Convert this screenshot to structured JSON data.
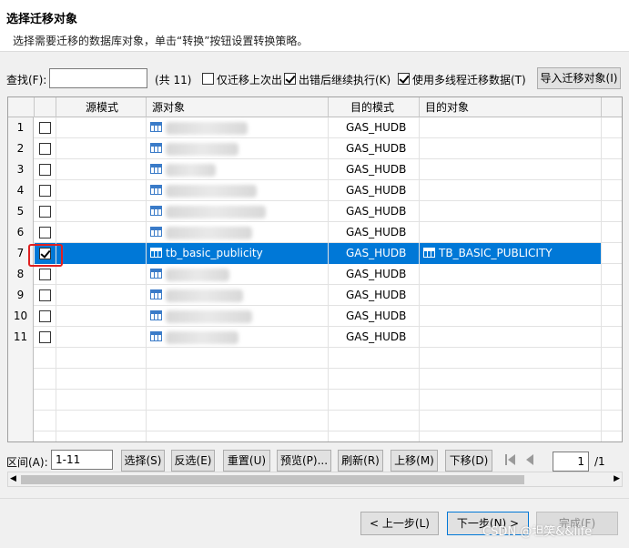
{
  "header": {
    "title": "选择迁移对象",
    "subtitle": "选择需要迁移的数据库对象，单击“转换”按钮设置转换策略。"
  },
  "toolbar": {
    "find_label": "查找(F):",
    "find_value": "",
    "count_text": "(共 11)",
    "opt_only_last_failed": {
      "label": "仅迁移上次出",
      "checked": false
    },
    "opt_continue_on_error": {
      "label": "出错后继续执行(K)",
      "checked": true
    },
    "opt_multithread": {
      "label": "使用多线程迁移数据(T)",
      "checked": true
    },
    "import_button": "导入迁移对象(I)"
  },
  "grid": {
    "columns": [
      "",
      "源模式",
      "源对象",
      "目的模式",
      "目的对象"
    ],
    "rows": [
      {
        "num": "1",
        "checked": false,
        "source_object": "",
        "target_schema": "GAS_HUDB",
        "target_object": "",
        "selected": false
      },
      {
        "num": "2",
        "checked": false,
        "source_object": "",
        "target_schema": "GAS_HUDB",
        "target_object": "",
        "selected": false
      },
      {
        "num": "3",
        "checked": false,
        "source_object": "",
        "target_schema": "GAS_HUDB",
        "target_object": "",
        "selected": false
      },
      {
        "num": "4",
        "checked": false,
        "source_object": "",
        "target_schema": "GAS_HUDB",
        "target_object": "",
        "selected": false
      },
      {
        "num": "5",
        "checked": false,
        "source_object": "",
        "target_schema": "GAS_HUDB",
        "target_object": "",
        "selected": false
      },
      {
        "num": "6",
        "checked": false,
        "source_object": "",
        "target_schema": "GAS_HUDB",
        "target_object": "",
        "selected": false
      },
      {
        "num": "7",
        "checked": true,
        "source_object": "tb_basic_publicity",
        "target_schema": "GAS_HUDB",
        "target_object": "TB_BASIC_PUBLICITY",
        "selected": true
      },
      {
        "num": "8",
        "checked": false,
        "source_object": "",
        "target_schema": "GAS_HUDB",
        "target_object": "",
        "selected": false
      },
      {
        "num": "9",
        "checked": false,
        "source_object": "",
        "target_schema": "GAS_HUDB",
        "target_object": "",
        "selected": false
      },
      {
        "num": "10",
        "checked": false,
        "source_object": "",
        "target_schema": "GAS_HUDB",
        "target_object": "",
        "selected": false
      },
      {
        "num": "11",
        "checked": false,
        "source_object": "",
        "target_schema": "GAS_HUDB",
        "target_object": "",
        "selected": false
      }
    ]
  },
  "bottom_bar": {
    "range_label": "区间(A):",
    "range_value": "1-11",
    "select_button": "选择(S)",
    "invert_button": "反选(E)",
    "reset_button": "重置(U)",
    "preview_button": "预览(P)...",
    "refresh_button": "刷新(R)",
    "move_up_button": "上移(M)",
    "move_down_button": "下移(D)",
    "page_value": "1",
    "page_total": "/1"
  },
  "footer": {
    "prev_button": "< 上一步(L)",
    "next_button": "下一步(N) >",
    "finish_button": "完成(F)",
    "watermark": "CSDN @坦笑&&life"
  },
  "colors": {
    "selection": "#0078d7",
    "highlight_box": "#e02020"
  }
}
